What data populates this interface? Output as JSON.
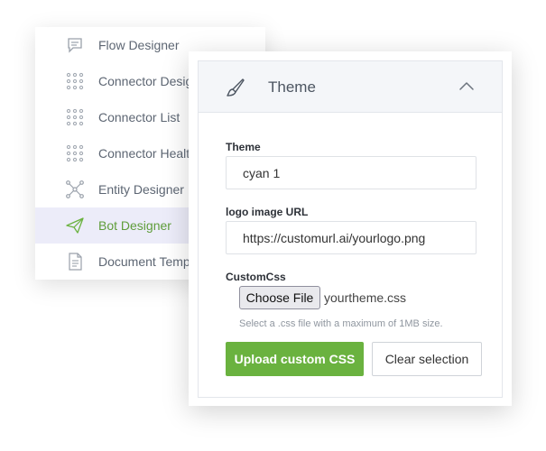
{
  "sidebar": {
    "items": [
      {
        "label": "Flow Designer",
        "icon": "chat-bubble-icon"
      },
      {
        "label": "Connector Designer",
        "icon": "grid-dots-icon"
      },
      {
        "label": "Connector List",
        "icon": "grid-dots-icon"
      },
      {
        "label": "Connector Health",
        "icon": "grid-dots-icon"
      },
      {
        "label": "Entity Designer",
        "icon": "network-nodes-icon"
      },
      {
        "label": "Bot Designer",
        "icon": "paper-plane-icon",
        "active": true
      },
      {
        "label": "Document Templates",
        "icon": "document-icon"
      }
    ]
  },
  "panel": {
    "title": "Theme",
    "icon": "paintbrush-icon",
    "collapse_icon": "chevron-up-icon",
    "theme": {
      "label": "Theme",
      "value": "cyan 1"
    },
    "logo": {
      "label": "logo image URL",
      "value": "https://customurl.ai/yourlogo.png"
    },
    "custom_css": {
      "label": "CustomCss",
      "choose_label": "Choose File",
      "file_name": "yourtheme.css",
      "hint": "Select a .css file with a maximum of 1MB size."
    },
    "upload_label": "Upload custom CSS",
    "clear_label": "Clear selection"
  },
  "colors": {
    "accent_green": "#6ab23f",
    "active_label": "#5f9d3a",
    "active_bg": "#ececf9"
  }
}
